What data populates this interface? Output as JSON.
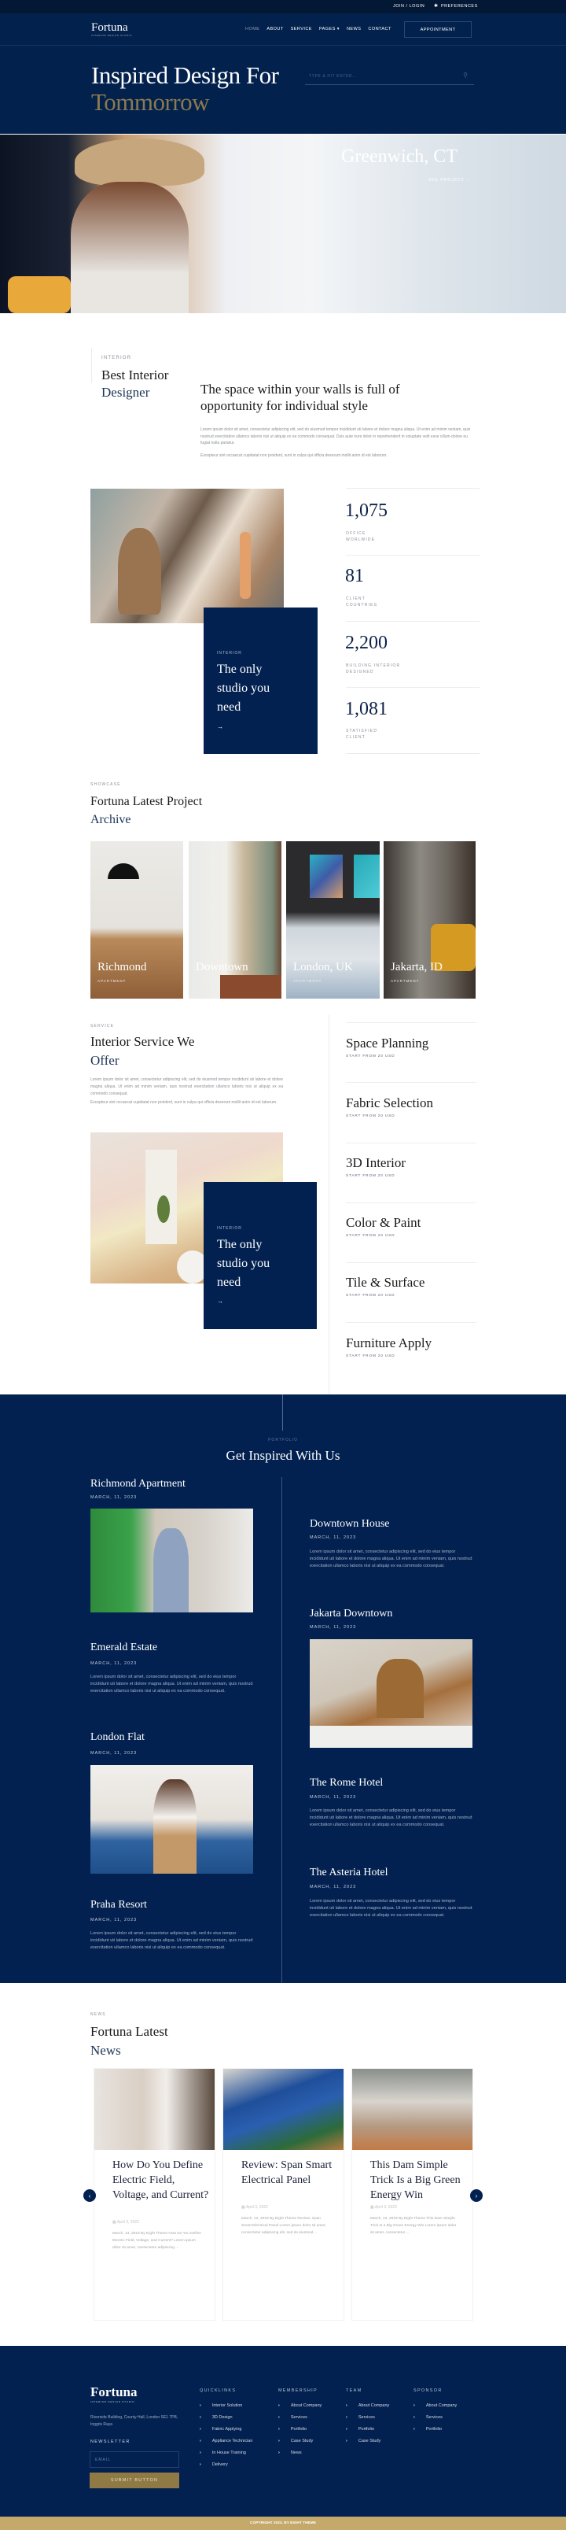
{
  "topbar": {
    "login": "JOIN / LOGIN",
    "preferences": "PREFERENCES"
  },
  "nav": {
    "logo": "Fortuna",
    "logo_sub": "INTERIOR DESIGN STUDIO",
    "items": [
      "HOME",
      "ABOUT",
      "SERVICE",
      "PAGES",
      "NEWS",
      "CONTACT"
    ],
    "active": "HOME",
    "cta": "APPOINTMENT"
  },
  "hero": {
    "line1": "Inspired Design For",
    "line2": "Tommorrow",
    "search_placeholder": "TYPE & HIT ENTER...",
    "slide_title": "Greenwich, CT",
    "slide_link": "SEE PROJECT →"
  },
  "intro": {
    "label": "INTERIOR",
    "title1": "Best Interior",
    "title2": "Designer",
    "heading": "The space within your walls is full of opportunity for individual style",
    "p1": "Lorem ipsum dolor sit amet, consectetur adipiscing elit, sed do eiusmod tempor incididunt uti labore et dolore magna aliqua. Ut enim ad minim veniam, quis nostrud exercitation ullamco laboris nisi ut aliquip ex ea commodo consequat. Duis aute irure dolor in reprehenderit in voluptate velit esse cillum dolore eu fugiat nulla pariatur.",
    "p2": "Excepteur sint occaecat cupidatat non proident, sunt in culpa qui officia deserunt mollit anim id est laborum."
  },
  "studio_box": {
    "label": "INTERIOR",
    "title": "The only studio you need",
    "arrow": "→"
  },
  "stats": [
    {
      "value": "1,075",
      "label": "OFFICE WORLWIDE"
    },
    {
      "value": "81",
      "label": "CLIENT COUNTRIES"
    },
    {
      "value": "2,200",
      "label": "BUILDING INTERIOR DESIGNED"
    },
    {
      "value": "1,081",
      "label": "STATISFIED CLIENT"
    }
  ],
  "showcase": {
    "label": "SHOWCASE",
    "title1": "Fortuna Latest Project",
    "title2": "Archive",
    "projects": [
      {
        "name": "Richmond",
        "type": "APARTMENT"
      },
      {
        "name": "Downtown",
        "type": "HOUSE"
      },
      {
        "name": "London, UK",
        "type": "APARTMENT"
      },
      {
        "name": "Jakarta, ID",
        "type": "APARTMENT"
      }
    ]
  },
  "service": {
    "label": "SERVICE",
    "title1": "Interior Service We",
    "title2": "Offer",
    "p1": "Lorem ipsum dolor sit amet, consectetur adipiscing elit, sed do eiusmod tempor incididunt uti labore et dolore magna aliqua. Ut enim ad minim veniam, quis nostrud exercitation ullamco laboris nisi ut aliquip ex ea commodo consequat.",
    "p2": "Excepteur sint occaecat cupidatat non proident, sunt in culpa qui officia deserunt mollit anim id est laborum.",
    "items": [
      {
        "name": "Space Planning",
        "price": "START FROM 20 USD"
      },
      {
        "name": "Fabric Selection",
        "price": "START FROM 20 USD"
      },
      {
        "name": "3D Interior",
        "price": "START FROM 20 USD"
      },
      {
        "name": "Color & Paint",
        "price": "START FROM 20 USD"
      },
      {
        "name": "Tile & Surface",
        "price": "START FROM 20 USD"
      },
      {
        "name": "Furniture Apply",
        "price": "START FROM 20 USD"
      }
    ]
  },
  "portfolio": {
    "label": "PORTFOLIO",
    "title": "Get Inspired With Us",
    "lorem": "Lorem ipsum dolor sit amet, consectetur adipiscing elit, sed do eius tempor incididunt uti labore et dolore magna aliqua. Ut enim ad minim veniam, quis nostrud exercitation ullamco laboris nisi ut aliquip ex ea commodo consequat.",
    "items": [
      {
        "title": "Richmond Apartment",
        "date": "MARCH, 11, 2023"
      },
      {
        "title": "Downtown House",
        "date": "MARCH, 11, 2023"
      },
      {
        "title": "Jakarta Downtown",
        "date": "MARCH, 11, 2023"
      },
      {
        "title": "Emerald Estate",
        "date": "MARCH, 11, 2023"
      },
      {
        "title": "London Flat",
        "date": "MARCH, 11, 2023"
      },
      {
        "title": "The Rome Hotel",
        "date": "MARCH, 11, 2023"
      },
      {
        "title": "The Asteria Hotel",
        "date": "MARCH, 11, 2023"
      },
      {
        "title": "Praha Resort",
        "date": "MARCH, 11, 2023"
      }
    ]
  },
  "news": {
    "label": "NEWS",
    "title1": "Fortuna Latest",
    "title2": "News",
    "posts": [
      {
        "title": "How Do You Define Electric Field, Voltage, and Current?",
        "date": "April 3, 2022",
        "excerpt": "March, 13, 2023 By Eight Theme How Do You Define Electric Field, Voltage, and Current? Lorem ipsum dolor sit amet, consectetur adipiscing ..."
      },
      {
        "title": "Review: Span Smart Electrical Panel",
        "date": "April 3, 2022",
        "excerpt": "March, 13, 2023 By Eight Theme Review: Span Smart Electrical Panel Lorem ipsum dolor sit amet, consectetur adipiscing elit, sed do eiusmod ..."
      },
      {
        "title": "This Dam Simple Trick Is a Big Green Energy Win",
        "date": "April 3, 2022",
        "excerpt": "March, 13, 2023 By Eight Theme This Dam Simple Trick Is a Big Green Energy Win Lorem ipsum dolor sit amet, consectetur ..."
      }
    ]
  },
  "footer": {
    "logo": "Fortuna",
    "logo_sub": "INTERIOR DESIGN STUDIO",
    "address": "Riverside Building, County Hall, London SE1 7PB, Inggris Raya",
    "newsletter": "NEWSLETTER",
    "email_placeholder": "EMAIL",
    "submit": "SUBMIT BUTTON",
    "columns": [
      {
        "title": "QUICKLINKS",
        "links": [
          "Interior Solution",
          "3D Design",
          "Fabric Applying",
          "Appliance Technician",
          "In House Training",
          "Delivery"
        ]
      },
      {
        "title": "MEMBERSHIP",
        "links": [
          "About Company",
          "Services",
          "Portfolio",
          "Case Study",
          "News"
        ]
      },
      {
        "title": "TEAM",
        "links": [
          "About Company",
          "Services",
          "Portfolio",
          "Case Study"
        ]
      },
      {
        "title": "SPONSOR",
        "links": [
          "About Company",
          "Services",
          "Portfolio"
        ]
      }
    ],
    "copyright": "COPYRIGHT 2023. BY EIGHT THEME"
  },
  "colors": {
    "navy": "#022150",
    "gold": "#8a7a4f",
    "copyright_bar": "#c5a96b",
    "button_gold": "#8f7a45"
  }
}
